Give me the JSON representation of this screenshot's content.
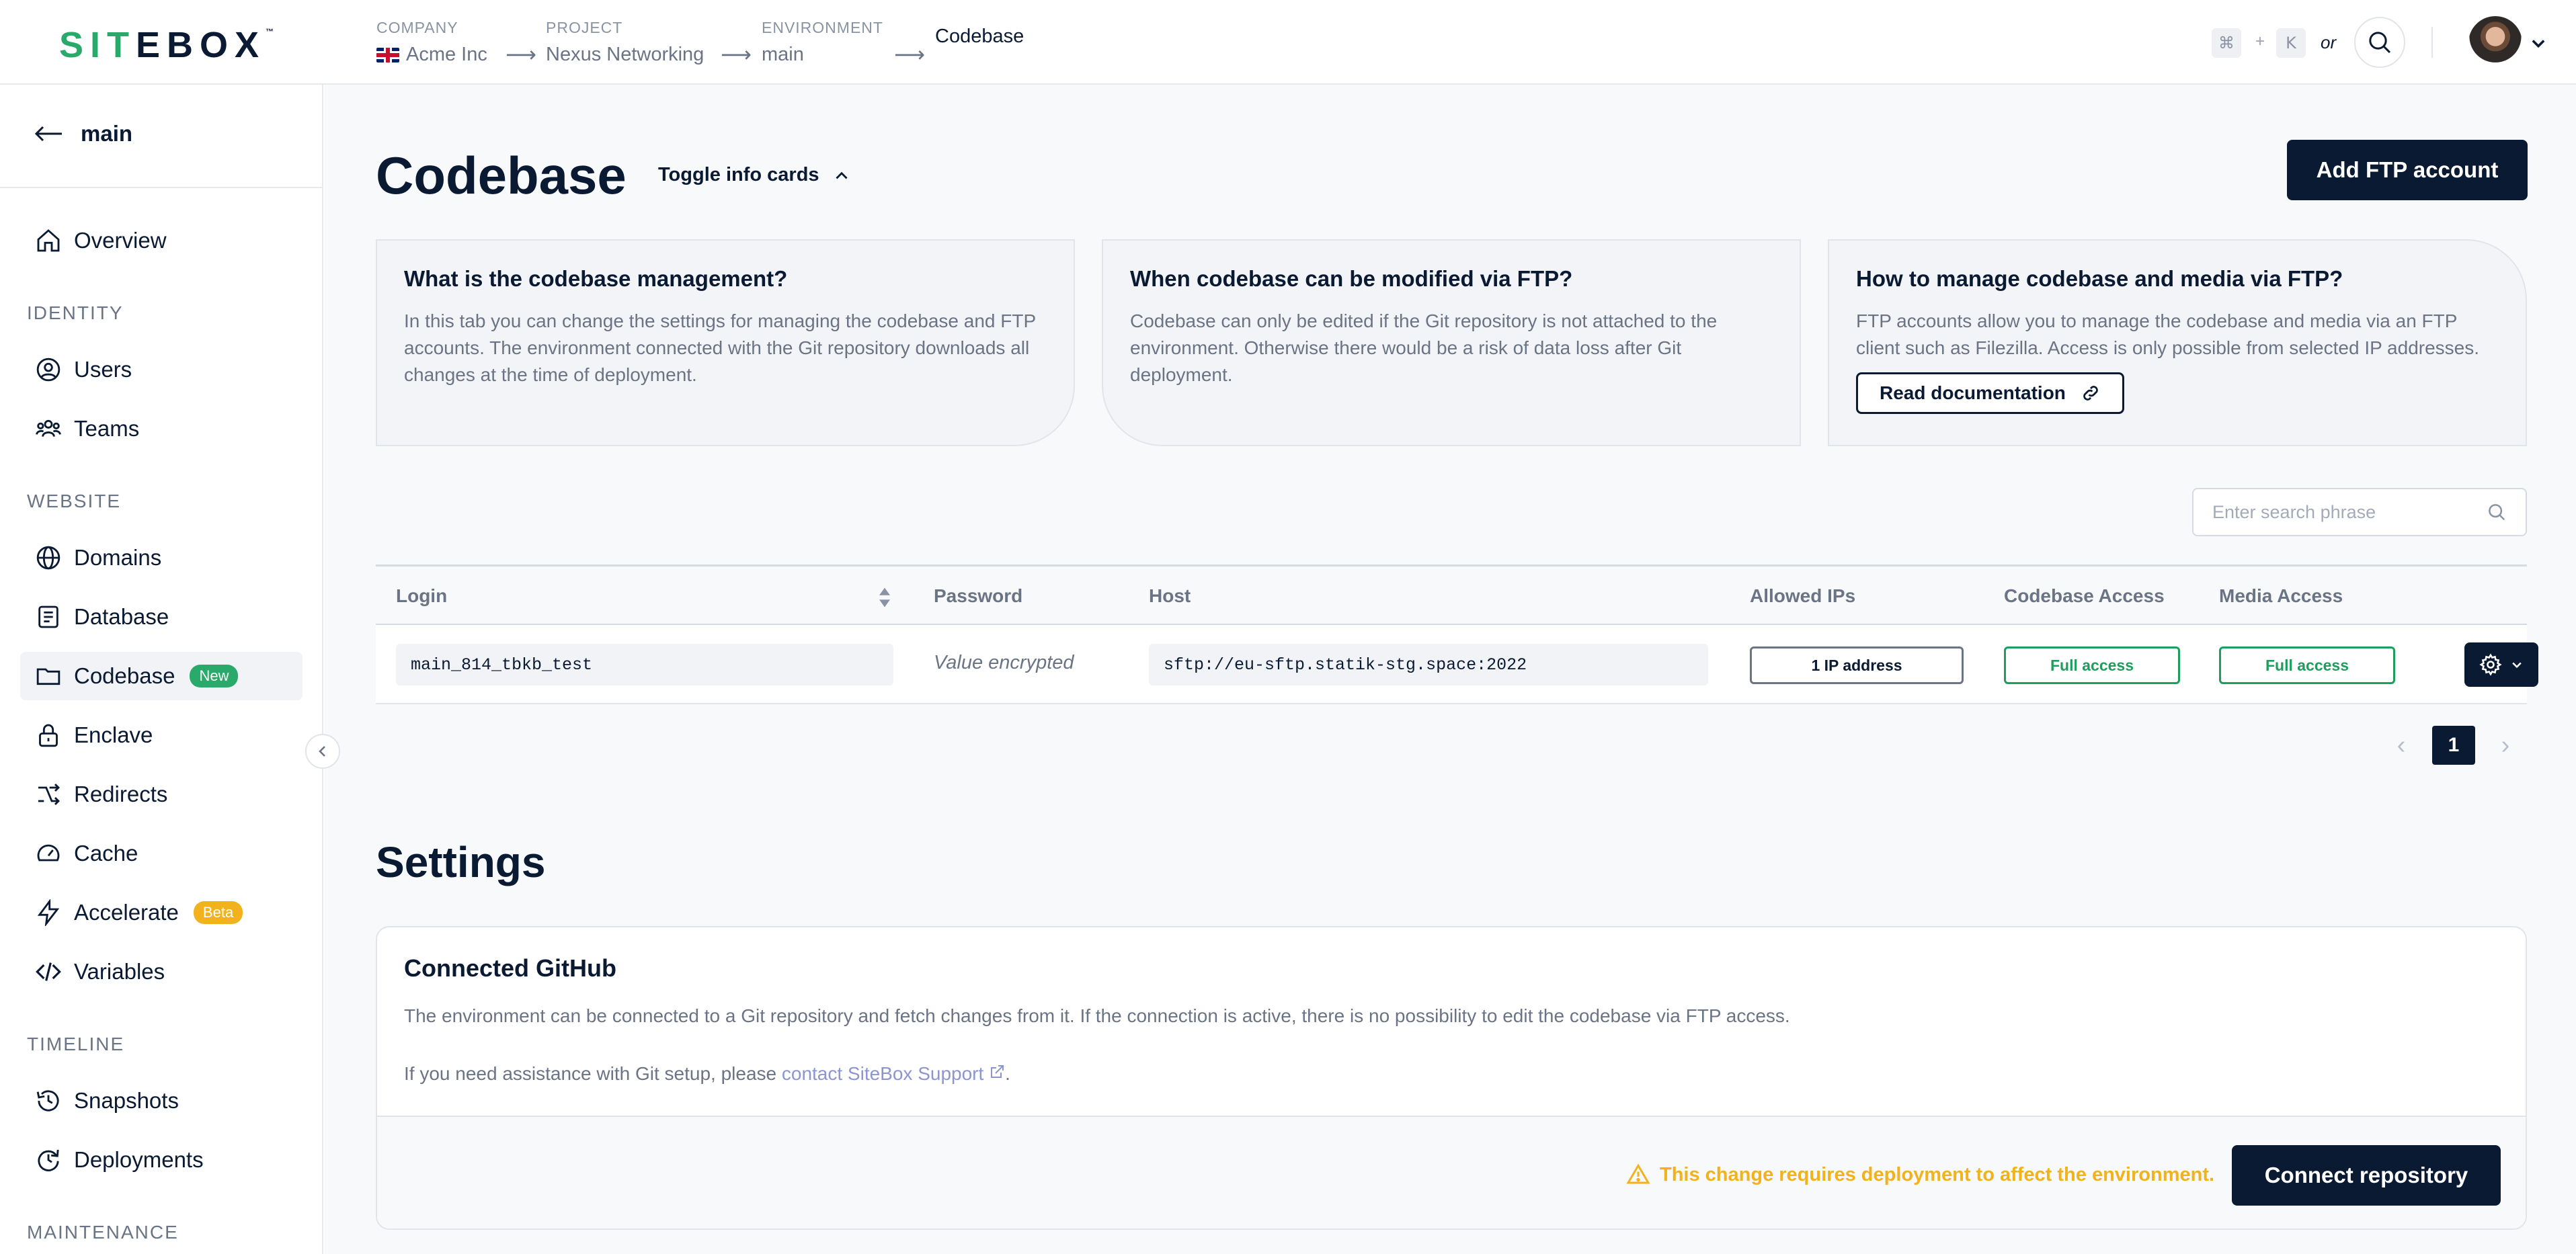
{
  "brand": {
    "logo_text_left": "SIT",
    "logo_text_mid": "E",
    "logo_text_right": "BOX",
    "logo_tm": "™"
  },
  "breadcrumb": [
    {
      "key": "COMPANY",
      "value": "Acme Inc"
    },
    {
      "key": "PROJECT",
      "value": "Nexus Networking"
    },
    {
      "key": "ENVIRONMENT",
      "value": "main"
    },
    {
      "key": "",
      "value": "Codebase"
    }
  ],
  "shortcut": {
    "cmd": "⌘",
    "plus": "+",
    "key": "K",
    "or": "or"
  },
  "sidebar": {
    "back_label": "main",
    "sections": {
      "identity": "IDENTITY",
      "website": "WEBSITE",
      "timeline": "TIMELINE",
      "maintenance": "MAINTENANCE"
    },
    "items": {
      "overview": "Overview",
      "users": "Users",
      "teams": "Teams",
      "domains": "Domains",
      "database": "Database",
      "codebase": "Codebase",
      "codebase_badge": "New",
      "enclave": "Enclave",
      "redirects": "Redirects",
      "cache": "Cache",
      "accelerate": "Accelerate",
      "accelerate_badge": "Beta",
      "variables": "Variables",
      "snapshots": "Snapshots",
      "deployments": "Deployments"
    }
  },
  "page": {
    "title": "Codebase",
    "toggle_label": "Toggle info cards",
    "add_button": "Add FTP account"
  },
  "info_cards": [
    {
      "title": "What is the codebase management?",
      "text": "In this tab you can change the settings for managing the codebase and FTP accounts. The environment connected with the Git repository downloads all changes at the time of deployment."
    },
    {
      "title": "When codebase can be modified via FTP?",
      "text": "Codebase can only be edited if the Git repository is not attached to the environment. Otherwise there would be a risk of data loss after Git deployment."
    },
    {
      "title": "How to manage codebase and media via FTP?",
      "text": "FTP accounts allow you to manage the codebase and media via an FTP client such as Filezilla. Access is only possible from selected IP addresses.",
      "button": "Read documentation"
    }
  ],
  "search": {
    "placeholder": "Enter search phrase"
  },
  "table": {
    "headers": {
      "login": "Login",
      "password": "Password",
      "host": "Host",
      "allowed_ips": "Allowed IPs",
      "codebase_access": "Codebase Access",
      "media_access": "Media Access"
    },
    "rows": [
      {
        "login": "main_814_tbkb_test",
        "password": "Value encrypted",
        "host": "sftp://eu-sftp.statik-stg.space:2022",
        "allowed_ips": "1 IP address",
        "codebase_access": "Full access",
        "media_access": "Full access"
      }
    ]
  },
  "pagination": {
    "current": "1",
    "prev": "‹",
    "next": "›"
  },
  "settings": {
    "title": "Settings",
    "github_title": "Connected GitHub",
    "github_desc": "The environment can be connected to a Git repository and fetch changes from it. If the connection is active, there is no possibility to edit the codebase via FTP access.",
    "help_prefix": "If you need assistance with Git setup, please ",
    "help_link": "contact SiteBox Support",
    "help_suffix": ".",
    "warning": "This change requires deployment to affect the environment.",
    "connect_button": "Connect repository"
  },
  "colors": {
    "primary": "#0b1a33",
    "accent_green": "#29a96a",
    "warning": "#f2b21e",
    "link": "#8c95d4"
  }
}
